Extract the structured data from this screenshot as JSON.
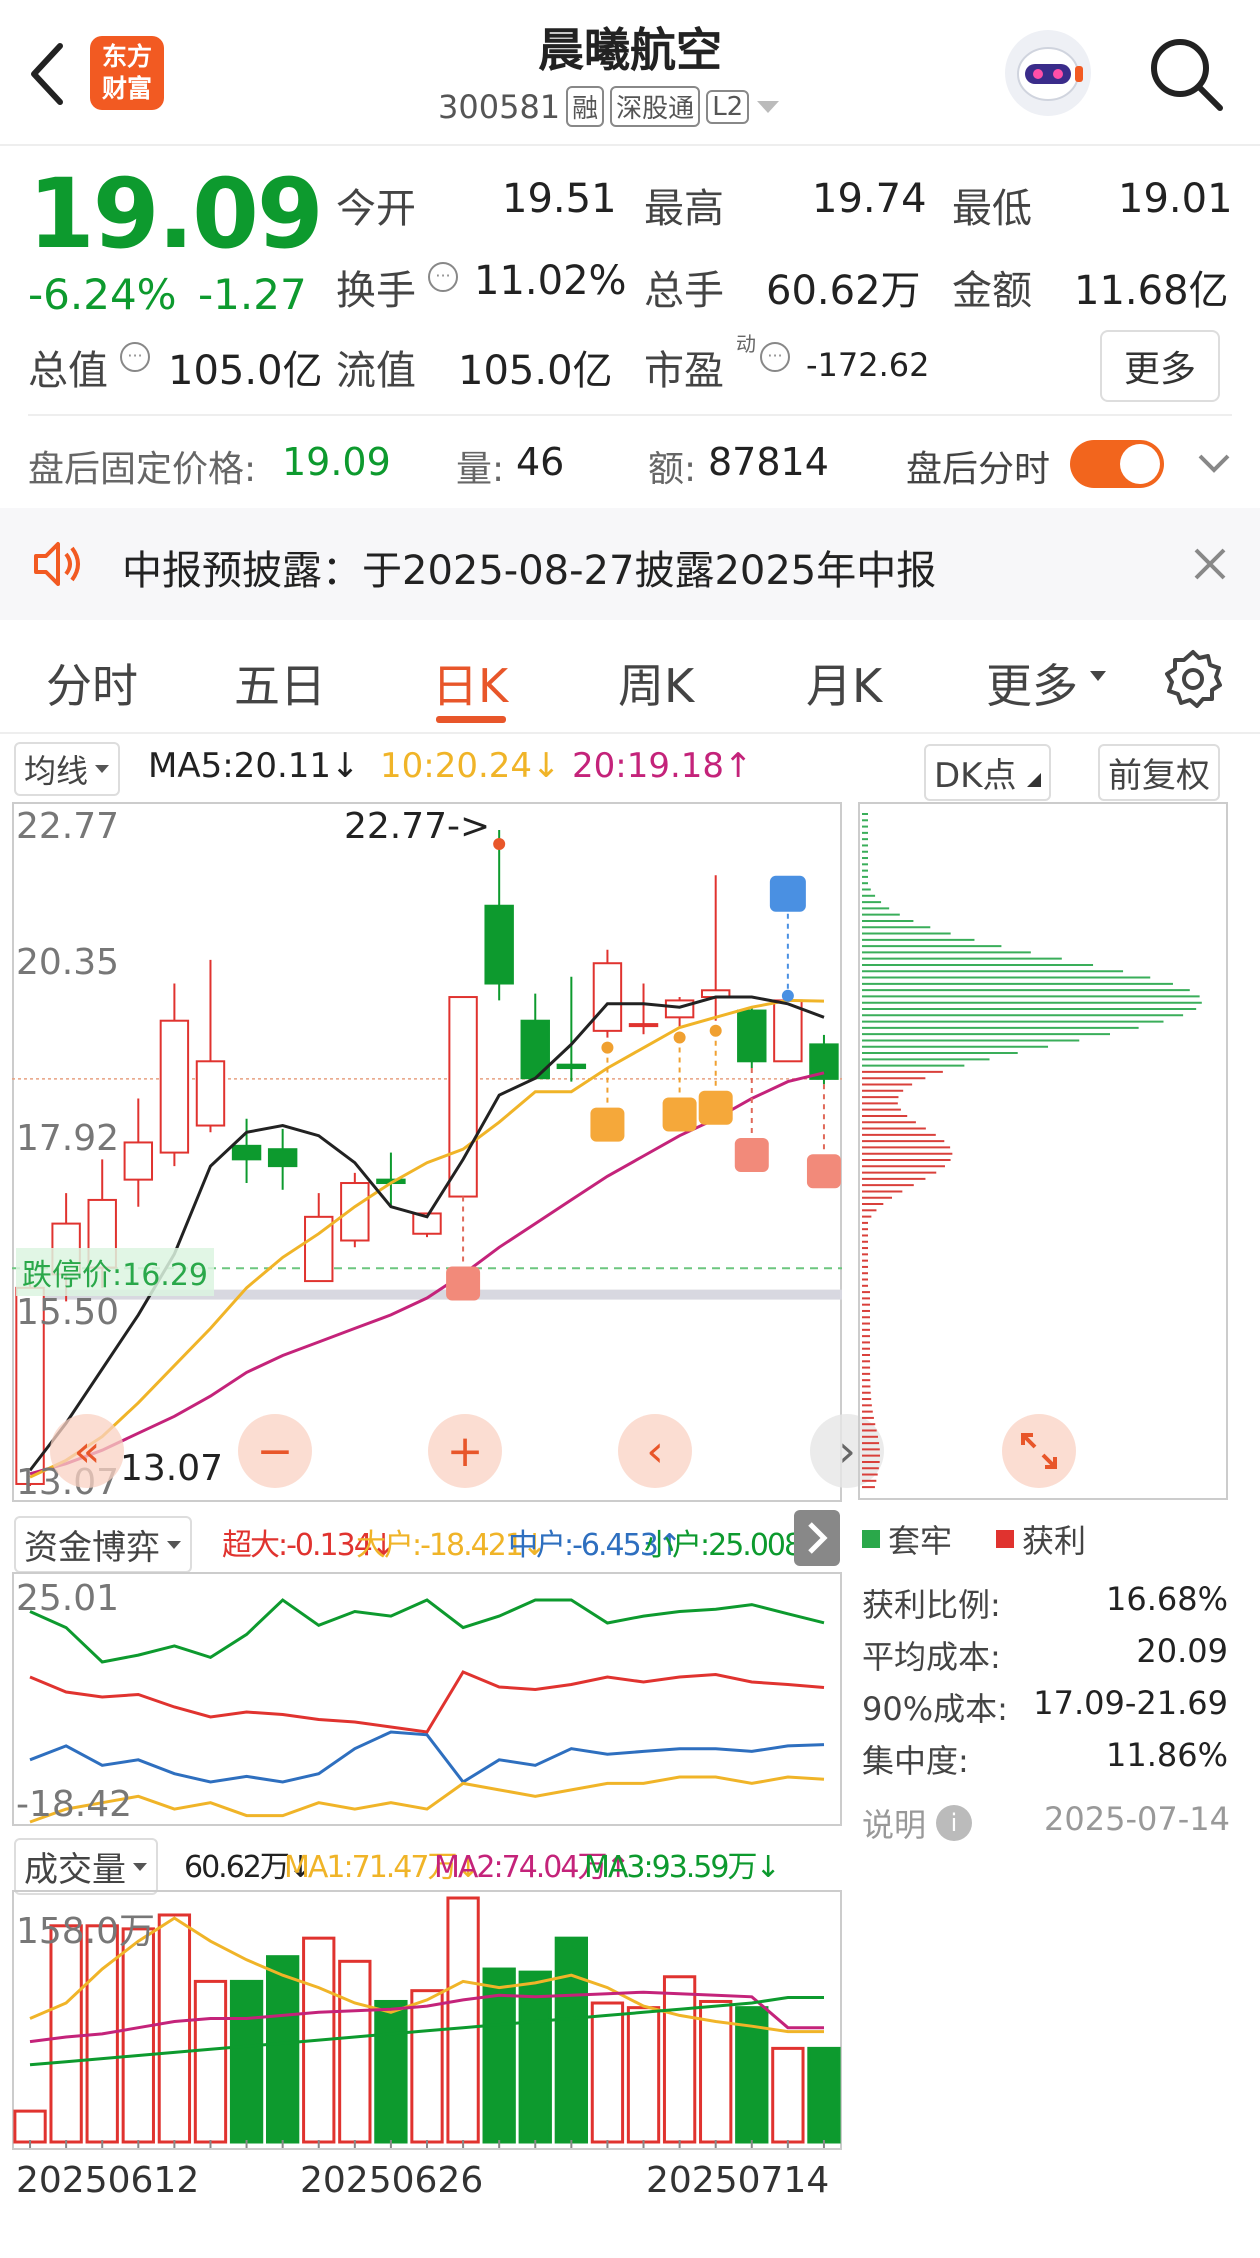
{
  "header": {
    "title": "晨曦航空",
    "code": "300581",
    "tags": [
      "融",
      "深股通",
      "L2"
    ],
    "logo_text": [
      "东方",
      "财富"
    ]
  },
  "quote": {
    "price": "19.09",
    "pct": "-6.24%",
    "chg": "-1.27",
    "open_label": "今开",
    "open": "19.51",
    "high_label": "最高",
    "high": "19.74",
    "low_label": "最低",
    "low": "19.01",
    "turnover_label": "换手",
    "turnover": "11.02%",
    "vol_label": "总手",
    "vol": "60.62万",
    "amount_label": "金额",
    "amount": "11.68亿",
    "mcap_label": "总值",
    "mcap": "105.0亿",
    "float_label": "流值",
    "float": "105.0亿",
    "pe_label": "市盈",
    "pe_sup": "动",
    "pe": "-172.62",
    "more": "更多"
  },
  "after_hours": {
    "price_label": "盘后固定价格:",
    "price": "19.09",
    "vol_label": "量:",
    "vol": "46",
    "amt_label": "额:",
    "amt": "87814",
    "toggle_label": "盘后分时"
  },
  "notice": {
    "text": "中报预披露：于2025-08-27披露2025年中报"
  },
  "tabs": [
    {
      "label": "分时"
    },
    {
      "label": "五日"
    },
    {
      "label": "日K"
    },
    {
      "label": "周K"
    },
    {
      "label": "月K"
    },
    {
      "label": "更多"
    }
  ],
  "ma_bar": {
    "selector": "均线",
    "ma5": "MA5:20.11↓",
    "ma10": "10:20.24↓",
    "ma20": "20:19.18↑",
    "dk": "DK点",
    "adjust": "前复权"
  },
  "colors": {
    "up": "#e0332f",
    "down": "#0d9a2e",
    "ma5": "#222222",
    "ma10": "#f0b428",
    "ma20": "#c4237a",
    "accent": "#e8562a"
  },
  "kchart": {
    "y_labels": [
      "22.77",
      "20.35",
      "17.92",
      "15.50",
      "13.07"
    ],
    "max_label": "22.77->",
    "min_label": "13.07",
    "limit_down": "跌停价:16.29"
  },
  "chart_data": [
    {
      "type": "candlestick",
      "title": "",
      "ylim": [
        13.07,
        22.77
      ],
      "candles": [
        {
          "o": 13.1,
          "h": 16.2,
          "l": 13.07,
          "c": 16.0
        },
        {
          "o": 16.2,
          "h": 17.4,
          "l": 15.8,
          "c": 16.95
        },
        {
          "o": 16.3,
          "h": 17.9,
          "l": 16.0,
          "c": 17.3
        },
        {
          "o": 17.6,
          "h": 18.8,
          "l": 17.2,
          "c": 18.15
        },
        {
          "o": 18.0,
          "h": 20.5,
          "l": 17.8,
          "c": 19.95
        },
        {
          "o": 18.4,
          "h": 20.85,
          "l": 18.3,
          "c": 19.35
        },
        {
          "o": 18.1,
          "h": 18.5,
          "l": 17.55,
          "c": 17.9
        },
        {
          "o": 18.05,
          "h": 18.35,
          "l": 17.45,
          "c": 17.8
        },
        {
          "o": 16.1,
          "h": 17.4,
          "l": 16.1,
          "c": 17.05
        },
        {
          "o": 16.7,
          "h": 17.7,
          "l": 16.6,
          "c": 17.55
        },
        {
          "o": 17.6,
          "h": 18.0,
          "l": 17.2,
          "c": 17.55
        },
        {
          "o": 16.8,
          "h": 17.1,
          "l": 16.75,
          "c": 17.1
        },
        {
          "o": 17.35,
          "h": 20.3,
          "l": 17.35,
          "c": 20.3
        },
        {
          "o": 21.65,
          "h": 22.77,
          "l": 20.25,
          "c": 20.5
        },
        {
          "o": 19.95,
          "h": 20.35,
          "l": 19.1,
          "c": 19.1
        },
        {
          "o": 19.3,
          "h": 20.6,
          "l": 19.05,
          "c": 19.25
        },
        {
          "o": 19.8,
          "h": 21.0,
          "l": 19.7,
          "c": 20.8
        },
        {
          "o": 19.9,
          "h": 20.5,
          "l": 19.75,
          "c": 19.9
        },
        {
          "o": 20.0,
          "h": 20.3,
          "l": 19.85,
          "c": 20.25
        },
        {
          "o": 20.3,
          "h": 22.1,
          "l": 19.95,
          "c": 20.4
        },
        {
          "o": 20.1,
          "h": 20.15,
          "l": 19.25,
          "c": 19.35
        },
        {
          "o": 19.35,
          "h": 20.2,
          "l": 19.35,
          "c": 20.25
        },
        {
          "o": 19.6,
          "h": 19.74,
          "l": 19.01,
          "c": 19.09
        }
      ],
      "ma5": [
        13.3,
        14.0,
        14.8,
        15.6,
        16.5,
        17.8,
        18.3,
        18.4,
        18.25,
        17.85,
        17.2,
        17.05,
        17.9,
        18.85,
        19.1,
        19.6,
        20.2,
        20.2,
        20.15,
        20.3,
        20.3,
        20.2,
        20.0
      ],
      "ma10": [
        13.2,
        13.45,
        13.8,
        14.3,
        14.85,
        15.4,
        16.0,
        16.45,
        16.8,
        17.2,
        17.55,
        17.85,
        18.05,
        18.45,
        18.9,
        18.9,
        19.25,
        19.55,
        19.85,
        20.0,
        20.15,
        20.25,
        20.24
      ],
      "ma20": [
        13.25,
        13.4,
        13.6,
        13.85,
        14.1,
        14.4,
        14.75,
        15.0,
        15.2,
        15.4,
        15.6,
        15.85,
        16.2,
        16.6,
        16.95,
        17.3,
        17.65,
        17.95,
        18.25,
        18.5,
        18.8,
        19.05,
        19.18
      ],
      "markers": [
        {
          "type": "B",
          "index": 12
        },
        {
          "type": "T",
          "index": 16
        },
        {
          "type": "T",
          "index": 18
        },
        {
          "type": "T",
          "index": 19
        },
        {
          "type": "B",
          "index": 20
        },
        {
          "type": "S",
          "index": 21
        },
        {
          "type": "B",
          "index": 22
        }
      ]
    },
    {
      "type": "line",
      "title": "资金博弈",
      "ylim": [
        -18.42,
        25.01
      ],
      "series": [
        {
          "name": "超大",
          "values": [
            -0.8,
            -0.6,
            -0.5,
            -0.4,
            -0.6,
            -0.5,
            -0.7,
            -0.7,
            -0.5,
            -0.6,
            -0.5,
            -0.6,
            -0.2,
            -0.3,
            -0.4,
            -0.3,
            -0.2,
            -0.2,
            -0.1,
            -0.1,
            -0.2,
            -0.1,
            -0.134
          ]
        },
        {
          "name": "大户",
          "values": [
            -18.0,
            -18.6,
            -18.8,
            -18.7,
            -19.2,
            -19.6,
            -19.4,
            -19.5,
            -19.7,
            -19.8,
            -20.0,
            -20.2,
            -17.8,
            -18.4,
            -18.5,
            -18.3,
            -18.0,
            -18.2,
            -18.0,
            -17.9,
            -18.2,
            -18.3,
            -18.421
          ]
        },
        {
          "name": "中户",
          "values": [
            -7.0,
            -6.5,
            -7.2,
            -7.0,
            -7.5,
            -7.8,
            -7.6,
            -7.8,
            -7.5,
            -6.6,
            -6.0,
            -6.1,
            -7.8,
            -7.0,
            -7.2,
            -6.6,
            -6.8,
            -6.7,
            -6.6,
            -6.6,
            -6.7,
            -6.5,
            -6.453
          ]
        },
        {
          "name": "小户",
          "values": [
            25.5,
            24.8,
            23.3,
            23.6,
            24.0,
            23.5,
            24.5,
            26.0,
            24.9,
            25.5,
            25.3,
            26.0,
            24.8,
            25.3,
            26.0,
            26.0,
            25.0,
            25.3,
            25.5,
            25.6,
            25.8,
            25.4,
            25.008
          ]
        }
      ]
    },
    {
      "type": "bar",
      "title": "成交量",
      "ylim": [
        0,
        158.0
      ],
      "unit": "万",
      "values": [
        20,
        140,
        140,
        138,
        147,
        104,
        104,
        120,
        132,
        117,
        91,
        98,
        158,
        112,
        110,
        132,
        90,
        87,
        107,
        91,
        87,
        60.62,
        60.62
      ],
      "ma1": [
        80,
        90,
        112,
        130,
        145,
        130,
        118,
        108,
        100,
        90,
        84,
        92,
        104,
        100,
        103,
        108,
        100,
        88,
        82,
        78,
        75,
        71.47,
        71.47
      ],
      "ma2": [
        65,
        68,
        70,
        74,
        78,
        80,
        80,
        82,
        84,
        85,
        86,
        88,
        92,
        95,
        94,
        95,
        96,
        97,
        96,
        95,
        94,
        74.04,
        74.04
      ],
      "ma3": [
        50,
        52,
        54,
        56,
        58,
        60,
        62,
        64,
        66,
        68,
        70,
        72,
        74,
        76,
        78,
        80,
        82,
        84,
        86,
        88,
        90,
        93.59,
        93.59
      ]
    }
  ],
  "volume": {
    "selector": "成交量",
    "cur": "60.62万↓",
    "ma1": "MA1:71.47万↓",
    "ma2": "MA2:74.04万↑",
    "ma3": "MA3:93.59万↓",
    "max_label": "158.0万",
    "dates": [
      "20250612",
      "20250626",
      "20250714"
    ]
  },
  "capital": {
    "selector": "资金博弈",
    "big": "超大:-0.134↓",
    "large": "大户:-18.421↓",
    "mid": "中户:-6.453↑",
    "small": "小户:25.008↑",
    "top_label": "25.01",
    "bottom_label": "-18.42"
  },
  "chips": {
    "legend_trap": "套牢",
    "legend_profit": "获利",
    "rows": [
      {
        "label": "获利比例:",
        "value": "16.68%"
      },
      {
        "label": "平均成本:",
        "value": "20.09"
      },
      {
        "label": "90%成本:",
        "value": "17.09-21.69"
      },
      {
        "label": "集中度:",
        "value": "11.86%"
      }
    ],
    "note_label": "说明",
    "date": "2025-07-14"
  }
}
